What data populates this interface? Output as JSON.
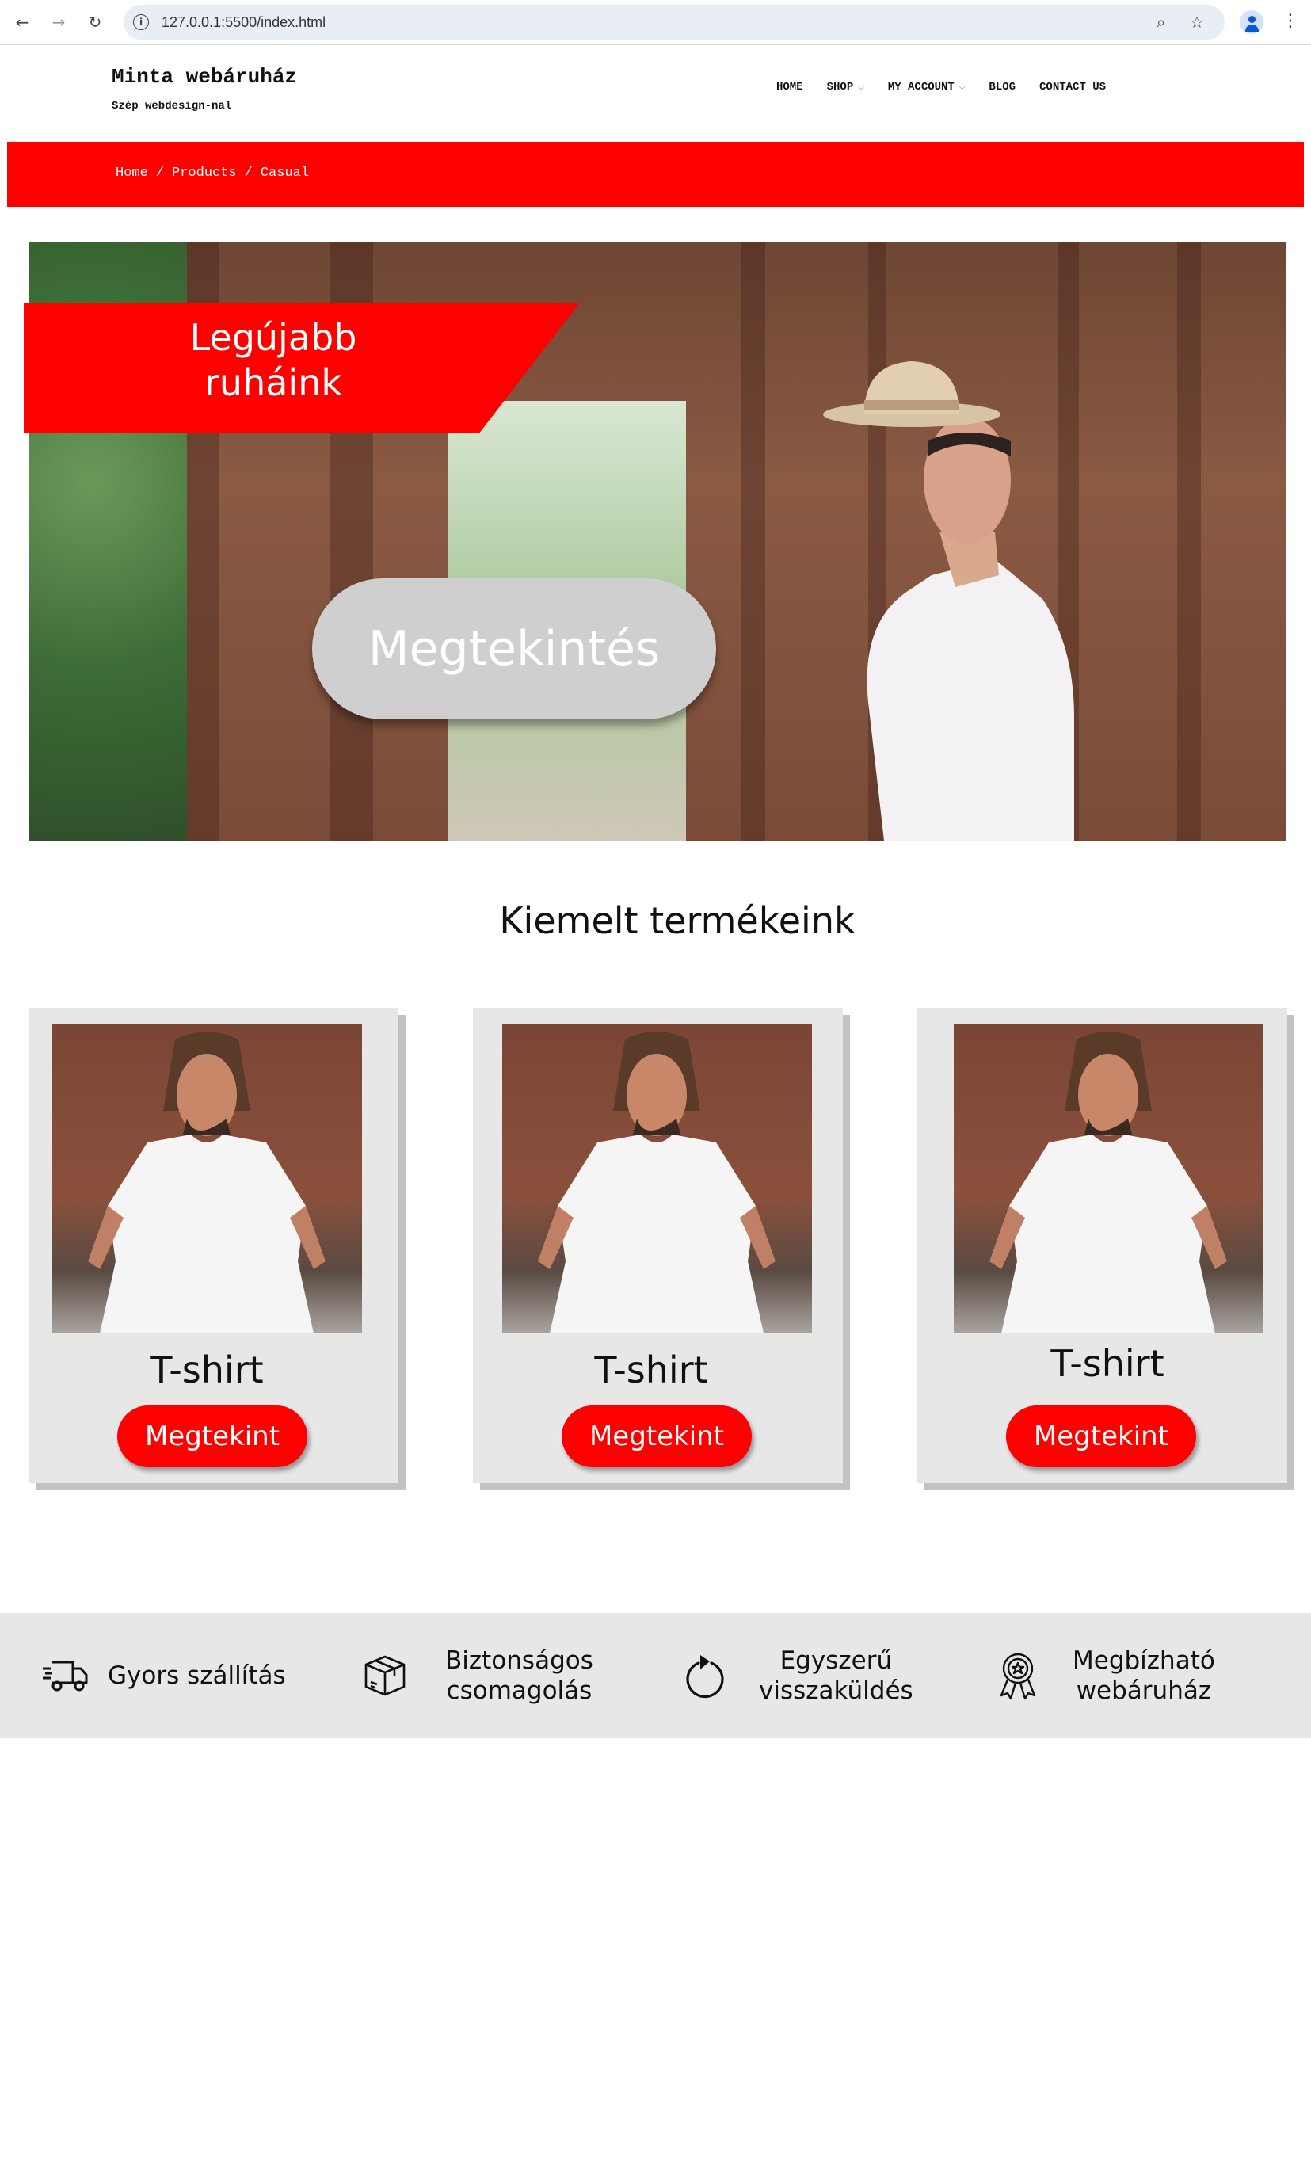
{
  "browser": {
    "url": "127.0.0.1:5500/index.html"
  },
  "header": {
    "brand_name": "Minta webáruház",
    "brand_tagline": "Szép webdesign-nal"
  },
  "nav": [
    {
      "label": "HOME",
      "has_dropdown": false
    },
    {
      "label": "SHOP",
      "has_dropdown": true
    },
    {
      "label": "MY ACCOUNT",
      "has_dropdown": true
    },
    {
      "label": "BLOG",
      "has_dropdown": false
    },
    {
      "label": "CONTACT US",
      "has_dropdown": false
    }
  ],
  "breadcrumb": [
    "Home",
    "Products",
    "Casual"
  ],
  "hero": {
    "tag_line1": "Legújabb",
    "tag_line2": "ruháink",
    "cta_label": "Megtekintés"
  },
  "featured": {
    "title": "Kiemelt termékeink",
    "products": [
      {
        "name": "T-shirt",
        "button_label": "Megtekint"
      },
      {
        "name": "T-shirt",
        "button_label": "Megtekint"
      },
      {
        "name": "T-shirt",
        "button_label": "Megtekint"
      }
    ]
  },
  "features": [
    {
      "icon": "delivery-truck-icon",
      "line1": "Gyors szállítás",
      "line2": ""
    },
    {
      "icon": "package-box-icon",
      "line1": "Biztonságos",
      "line2": "csomagolás"
    },
    {
      "icon": "return-arrow-icon",
      "line1": "Egyszerű",
      "line2": "visszaküldés"
    },
    {
      "icon": "award-badge-icon",
      "line1": "Megbízható",
      "line2": "webáruház"
    }
  ],
  "colors": {
    "accent": "#ff0000",
    "card_bg": "#e7e7e7",
    "hero_button": "#cfcfcf"
  }
}
